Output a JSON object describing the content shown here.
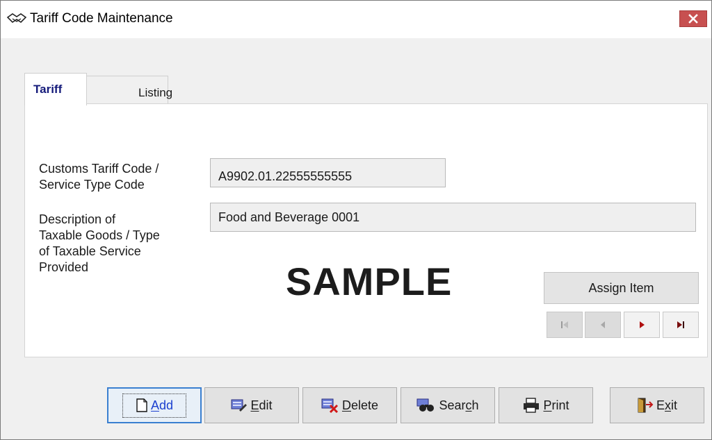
{
  "window": {
    "title": "Tariff Code Maintenance"
  },
  "tabs": [
    {
      "label": "Tariff",
      "active": true
    },
    {
      "label": "Listing",
      "active": false
    }
  ],
  "form": {
    "tariff_code_label_1": "Customs Tariff Code /",
    "tariff_code_label_2": "Service Type Code",
    "tariff_code_value": "A9902.01.22555555555",
    "description_label_1": "Description of",
    "description_label_2": "Taxable Goods / Type",
    "description_label_3": "of Taxable Service",
    "description_label_4": "Provided",
    "description_value": "Food and Beverage 0001"
  },
  "watermark": "SAMPLE",
  "assign_item_label": "Assign Item",
  "navigation": {
    "first": {
      "icon": "first-record-icon",
      "enabled": false
    },
    "previous": {
      "icon": "previous-record-icon",
      "enabled": false
    },
    "next": {
      "icon": "next-record-icon",
      "enabled": true
    },
    "last": {
      "icon": "last-record-icon",
      "enabled": true
    }
  },
  "toolbar": {
    "add": {
      "pre": "",
      "key": "A",
      "post": "dd",
      "icon": "new-document-icon"
    },
    "edit": {
      "pre": "",
      "key": "E",
      "post": "dit",
      "icon": "edit-icon"
    },
    "delete": {
      "pre": "",
      "key": "D",
      "post": "elete",
      "icon": "delete-icon"
    },
    "search": {
      "pre": "Sear",
      "key": "c",
      "post": "h",
      "icon": "binoculars-icon"
    },
    "print": {
      "pre": "",
      "key": "P",
      "post": "rint",
      "icon": "printer-icon"
    },
    "exit": {
      "pre": "E",
      "key": "x",
      "post": "it",
      "icon": "exit-door-icon"
    }
  },
  "colors": {
    "accent_blue": "#1a3fcf",
    "tab_active_text": "#141a7a",
    "close_button": "#c75050",
    "nav_arrow_red": "#b01010",
    "nav_arrow_dark": "#6a1010"
  }
}
